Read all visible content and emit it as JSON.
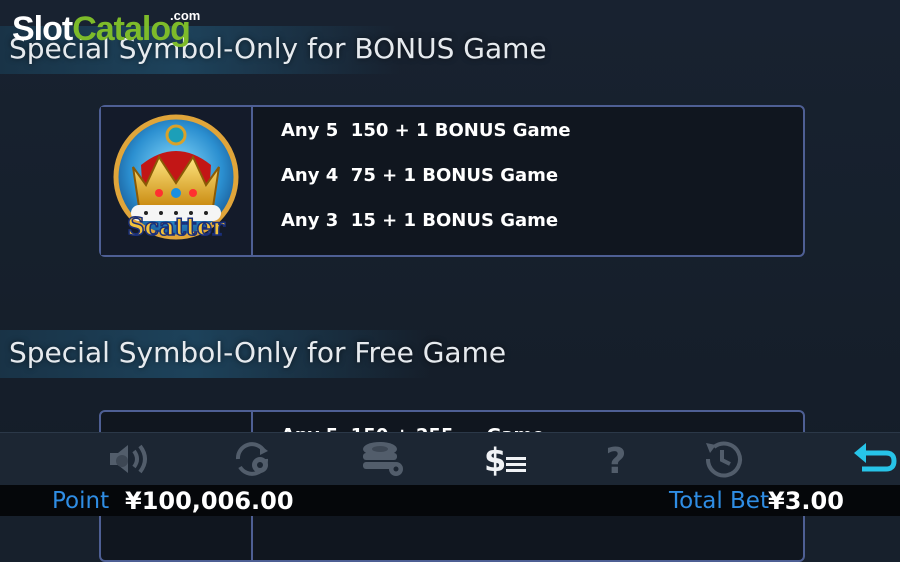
{
  "watermark": {
    "brand_part1": "Slot",
    "brand_part2": "Catalog",
    "brand_suffix": ".com"
  },
  "sections": [
    {
      "title": "Special Symbol-Only for BONUS Game",
      "symbol": {
        "icon": "scatter-crown-icon",
        "label": "Scatter"
      },
      "pays": [
        "Any 5  150 + 1 BONUS Game",
        "Any 4  75 + 1 BONUS Game",
        "Any 3  15 + 1 BONUS Game"
      ]
    },
    {
      "title": "Special Symbol-Only for Free Game",
      "pays": [
        "Any 5  150 + 255 ... Game"
      ]
    }
  ],
  "toolbar": {
    "icons": [
      "sound-settings-icon",
      "autoplay-settings-icon",
      "chip-settings-icon",
      "paytable-icon",
      "help-icon",
      "history-icon",
      "back-icon"
    ]
  },
  "status": {
    "point_label": "Point",
    "point_value": "¥100,006.00",
    "total_bet_label": "Total Bet",
    "total_bet_value": "¥3.00"
  },
  "colors": {
    "accent": "#2f8de4",
    "back_arrow": "#27c4e8",
    "box_border": "#4e5f94"
  }
}
